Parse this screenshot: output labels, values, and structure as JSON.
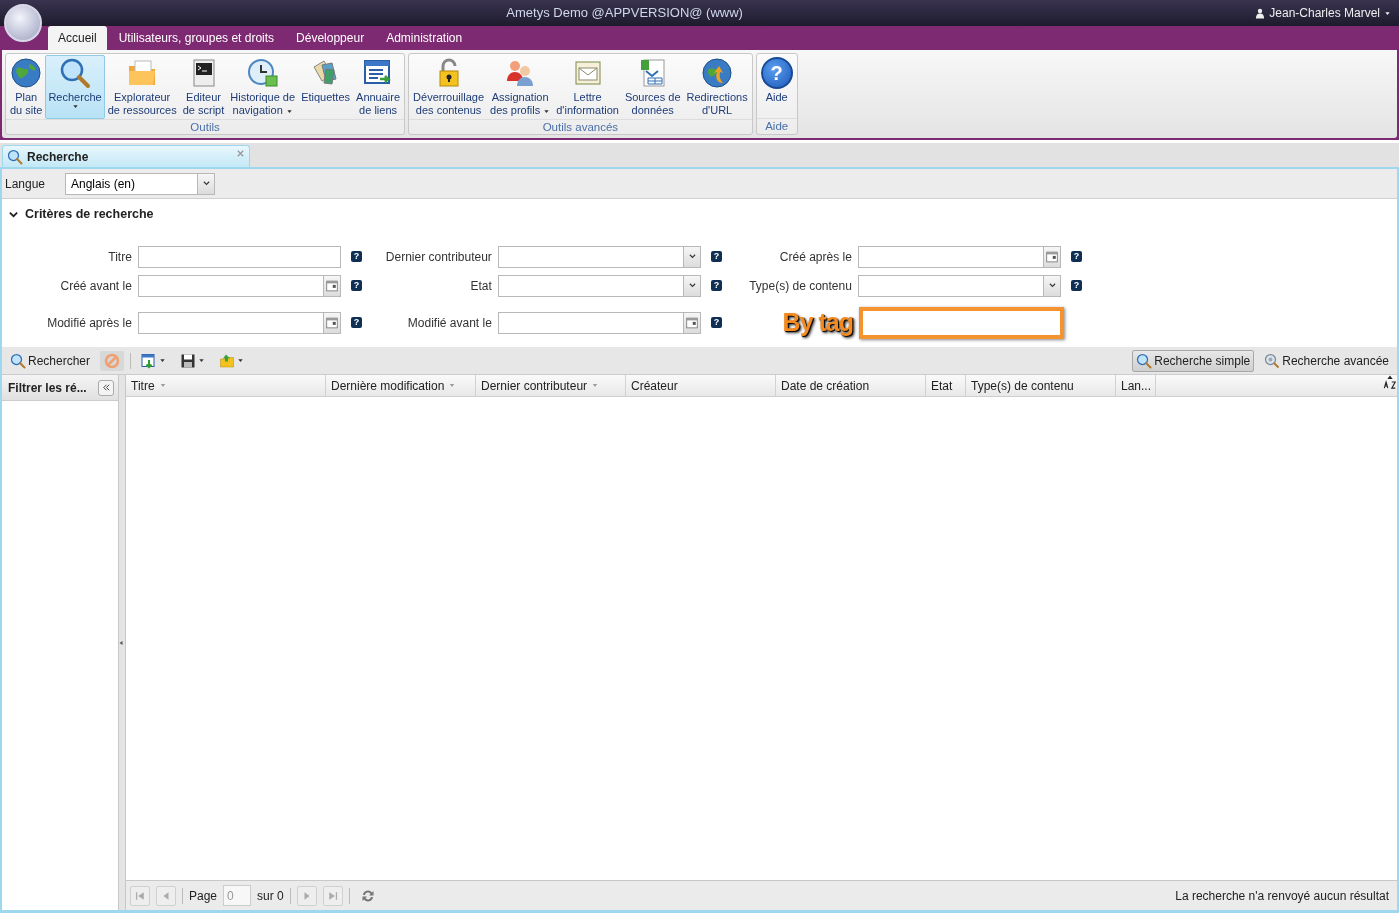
{
  "window": {
    "title": "Ametys Demo @APPVERSION@ (www)",
    "user": "Jean-Charles Marvel"
  },
  "tabs": [
    {
      "label": "Accueil",
      "selected": true
    },
    {
      "label": "Utilisateurs, groupes et droits",
      "selected": false
    },
    {
      "label": "Développeur",
      "selected": false
    },
    {
      "label": "Administration",
      "selected": false
    }
  ],
  "ribbon": [
    {
      "label": "Outils",
      "buttons": [
        {
          "kind": "globe",
          "lines": [
            "Plan",
            "du site"
          ],
          "menu": false,
          "selected": false
        },
        {
          "kind": "search",
          "lines": [
            "Recherche"
          ],
          "menu": true,
          "selected": true
        },
        {
          "kind": "folder",
          "lines": [
            "Explorateur",
            "de ressources"
          ],
          "menu": false,
          "selected": false
        },
        {
          "kind": "terminal",
          "lines": [
            "Editeur",
            "de script"
          ],
          "menu": false,
          "selected": false
        },
        {
          "kind": "clock",
          "lines": [
            "Historique de",
            "navigation"
          ],
          "menu": true,
          "selected": false
        },
        {
          "kind": "tags",
          "lines": [
            "Etiquettes"
          ],
          "menu": false,
          "selected": false
        },
        {
          "kind": "list",
          "lines": [
            "Annuaire",
            "de liens"
          ],
          "menu": false,
          "selected": false
        }
      ]
    },
    {
      "label": "Outils avancés",
      "buttons": [
        {
          "kind": "lock",
          "lines": [
            "Déverrouillage",
            "des contenus"
          ],
          "menu": false,
          "selected": false
        },
        {
          "kind": "people",
          "lines": [
            "Assignation",
            "des profils"
          ],
          "menu": true,
          "selected": false
        },
        {
          "kind": "letter",
          "lines": [
            "Lettre",
            "d'information"
          ],
          "menu": false,
          "selected": false
        },
        {
          "kind": "database",
          "lines": [
            "Sources de",
            "données"
          ],
          "menu": false,
          "selected": false
        },
        {
          "kind": "redirect",
          "lines": [
            "Redirections",
            "d'URL"
          ],
          "menu": false,
          "selected": false
        }
      ]
    },
    {
      "label": "Aide",
      "buttons": [
        {
          "kind": "help",
          "glyph": "?",
          "lines": [
            "Aide"
          ],
          "menu": false,
          "selected": false
        }
      ]
    }
  ],
  "document_tab": {
    "label": "Recherche"
  },
  "language": {
    "label": "Langue",
    "value": "Anglais (en)"
  },
  "criteria": {
    "title": "Critères de recherche",
    "expanded": true,
    "rows": [
      [
        {
          "label": "Titre",
          "kind": "text",
          "help": "?"
        },
        {
          "label": "Dernier contributeur",
          "kind": "combo",
          "help": "?"
        },
        {
          "label": "Créé après le",
          "kind": "date",
          "help": "?"
        }
      ],
      [
        {
          "label": "Créé avant le",
          "kind": "date",
          "help": "?"
        },
        {
          "label": "Etat",
          "kind": "combo",
          "help": "?"
        },
        {
          "label": "Type(s) de contenu",
          "kind": "combo",
          "help": "?"
        }
      ],
      [
        {
          "label": "Modifié après le",
          "kind": "date",
          "help": "?"
        },
        {
          "label": "Modifié avant le",
          "kind": "date",
          "help": "?"
        },
        {
          "label": "By tag",
          "kind": "tag"
        }
      ]
    ]
  },
  "toolbar": {
    "actions": [
      {
        "kind": "search",
        "label": "Rechercher",
        "menu": false
      },
      {
        "kind": "cancel",
        "menu": false
      },
      {
        "kind": "export",
        "menu": true
      },
      {
        "kind": "save",
        "menu": true
      },
      {
        "kind": "open",
        "menu": true
      }
    ],
    "modes": [
      {
        "kind": "simple",
        "label": "Recherche simple",
        "selected": true
      },
      {
        "kind": "advanced",
        "label": "Recherche avancée",
        "selected": false
      }
    ]
  },
  "filter_panel": {
    "title": "Filtrer les ré..."
  },
  "table": {
    "columns": [
      {
        "label": "Titre",
        "menu": true
      },
      {
        "label": "Dernière modification",
        "menu": true
      },
      {
        "label": "Dernier contributeur",
        "menu": true
      },
      {
        "label": "Créateur",
        "menu": false
      },
      {
        "label": "Date de création",
        "menu": false
      },
      {
        "label": "Etat",
        "menu": false
      },
      {
        "label": "Type(s) de contenu",
        "menu": false
      },
      {
        "label": "Lan...",
        "menu": false
      }
    ]
  },
  "paging": {
    "page_label": "Page",
    "page": "0",
    "of": "sur 0",
    "status": "La recherche n'a renvoyé aucun résultat"
  }
}
